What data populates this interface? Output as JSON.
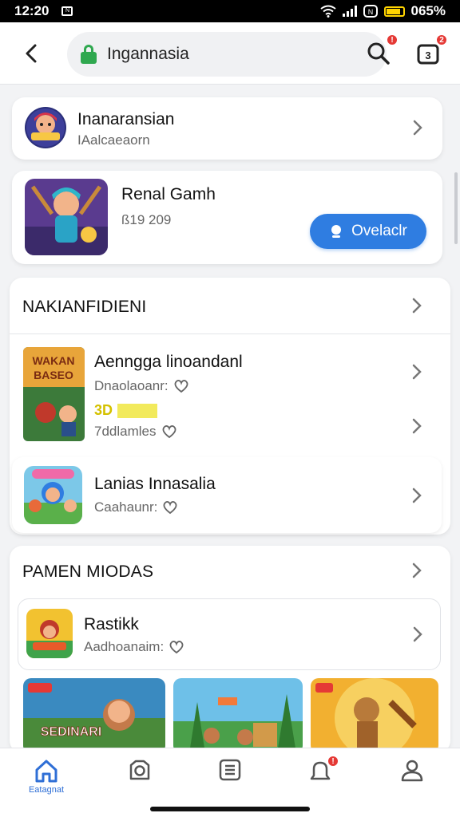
{
  "status": {
    "time": "12:20",
    "battery": "065%"
  },
  "topbar": {
    "url": "Ingannasia",
    "search_badge": "!",
    "tabs_badge": "2"
  },
  "featured": {
    "publisher": {
      "name": "Inanaransian",
      "handle": "IAalcaeaorn"
    },
    "game": {
      "name": "Renal Gamh",
      "meta": "ß19 209",
      "install_label": "Ovelaclr"
    }
  },
  "section1": {
    "title": "NAKIANFIDIENI",
    "items": [
      {
        "name": "Aenngga linoandanl",
        "line1": "Dnaolaoanr:",
        "tag": "3D",
        "line2": "7ddlamles"
      },
      {
        "name": "Lanias Innasalia",
        "line1": "Caahaunr:"
      }
    ]
  },
  "section2": {
    "title": "PAMEN MIODAS",
    "items": [
      {
        "name": "Rastikk",
        "line1": "Aadhoanaim:"
      }
    ]
  },
  "nav": {
    "home_label": "Eatagnat",
    "notif_badge": "!"
  },
  "colors": {
    "accent": "#2f7de1",
    "lock": "#2fa84f",
    "badge": "#e53935"
  }
}
